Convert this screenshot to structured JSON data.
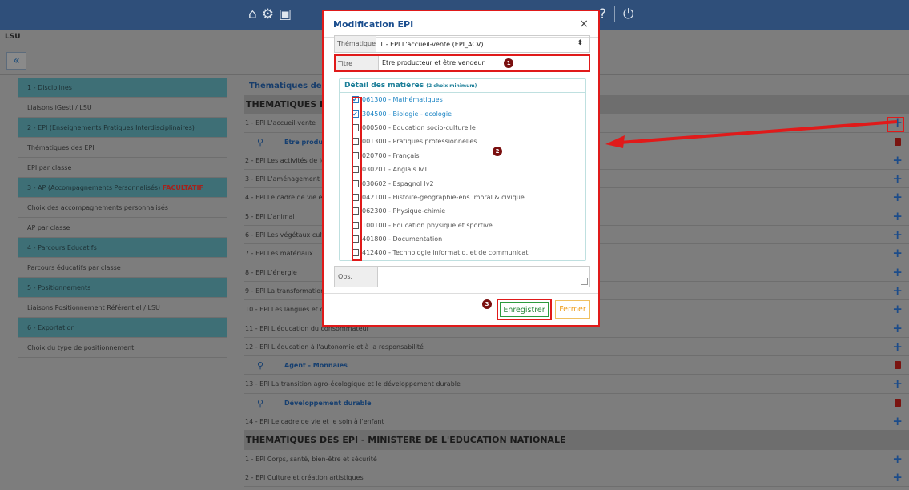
{
  "page": {
    "title": "LSU",
    "collapse_label": "«"
  },
  "sidebar": [
    {
      "label": "1 - Disciplines",
      "head": true
    },
    {
      "label": "Liaisons iGesti / LSU",
      "head": false
    },
    {
      "label": "2 - EPI (Enseignements Pratiques Interdisciplinaires)",
      "head": true
    },
    {
      "label": "Thématiques des EPI",
      "head": false
    },
    {
      "label": "EPI par classe",
      "head": false
    },
    {
      "label": "3 - AP (Accompagnements Personnalisés)",
      "suffix": "FACULTATIF",
      "head": true
    },
    {
      "label": "Choix des accompagnements personnalisés",
      "head": false
    },
    {
      "label": "AP par classe",
      "head": false
    },
    {
      "label": "4 - Parcours Educatifs",
      "head": true
    },
    {
      "label": "Parcours éducatifs par classe",
      "head": false
    },
    {
      "label": "5 - Positionnements",
      "head": true
    },
    {
      "label": "Liaisons Positionnement Référentiel / LSU",
      "head": false
    },
    {
      "label": "6 - Exportation",
      "head": true
    },
    {
      "label": "Choix du type de positionnement",
      "head": false
    }
  ],
  "main": {
    "section_title": "Thématiques de re",
    "rows": [
      {
        "type": "header",
        "label": "THEMATIQUES DE"
      },
      {
        "type": "item",
        "label": "1 - EPI L'accueil-vente"
      },
      {
        "type": "sub",
        "label": "Etre produc",
        "action": "trash"
      },
      {
        "type": "item",
        "label": "2 - EPI Les activités de le"
      },
      {
        "type": "item",
        "label": "3 - EPI L'aménagement"
      },
      {
        "type": "item",
        "label": "4 - EPI Le cadre de vie e"
      },
      {
        "type": "item",
        "label": "5 - EPI L'animal"
      },
      {
        "type": "item",
        "label": "6 - EPI Les végétaux cult"
      },
      {
        "type": "item",
        "label": "7 - EPI Les matériaux"
      },
      {
        "type": "item",
        "label": "8 - EPI L'énergie"
      },
      {
        "type": "item",
        "label": "9 - EPI La transformation"
      },
      {
        "type": "item",
        "label": "10 - EPI Les langues et c"
      },
      {
        "type": "item",
        "label": "11 - EPI L'éducation du consommateur"
      },
      {
        "type": "item",
        "label": "12 - EPI L'éducation à l'autonomie et à la responsabilité"
      },
      {
        "type": "sub",
        "label": "Agent - Monnaies",
        "action": "trash"
      },
      {
        "type": "item",
        "label": "13 - EPI La transition agro-écologique et le développement durable"
      },
      {
        "type": "sub",
        "label": "Développement durable",
        "action": "trash"
      },
      {
        "type": "item",
        "label": "14 - EPI Le cadre de vie et le soin à l'enfant"
      },
      {
        "type": "header",
        "label": "THEMATIQUES DES EPI - MINISTERE DE L'EDUCATION NATIONALE"
      },
      {
        "type": "item",
        "label": "1 - EPI Corps, santé, bien-être et sécurité"
      },
      {
        "type": "item",
        "label": "2 - EPI Culture et création artistiques"
      }
    ]
  },
  "modal": {
    "title": "Modification EPI",
    "close": "×",
    "thematique_label": "Thématique",
    "thematique_value": "1 - EPI L'accueil-vente (EPI_ACV)",
    "titre_label": "Titre",
    "titre_value": "Etre producteur et être vendeur",
    "matieres_title": "Détail des matières",
    "matieres_hint": "(2 choix minimum)",
    "matieres": [
      {
        "label": "061300 - Mathématiques",
        "checked": true
      },
      {
        "label": "304500 - Biologie - ecologie",
        "checked": true
      },
      {
        "label": "000500 - Education socio-culturelle",
        "checked": false
      },
      {
        "label": "001300 - Pratiques professionnelles",
        "checked": false
      },
      {
        "label": "020700 - Français",
        "checked": false
      },
      {
        "label": "030201 - Anglais lv1",
        "checked": false
      },
      {
        "label": "030602 - Espagnol lv2",
        "checked": false
      },
      {
        "label": "042100 - Histoire-geographie-ens. moral & civique",
        "checked": false
      },
      {
        "label": "062300 - Physique-chimie",
        "checked": false
      },
      {
        "label": "100100 - Education physique et sportive",
        "checked": false
      },
      {
        "label": "401800 - Documentation",
        "checked": false
      },
      {
        "label": "412400 - Technologie informatiq. et de communicat",
        "checked": false
      }
    ],
    "obs_label": "Obs.",
    "save_label": "Enregistrer",
    "cancel_label": "Fermer",
    "badges": [
      "1",
      "2",
      "3"
    ]
  },
  "colors": {
    "annotation": "#e01a1a",
    "accent": "#1c4f8f",
    "save": "#2c8a3c",
    "cancel": "#f0a020"
  }
}
